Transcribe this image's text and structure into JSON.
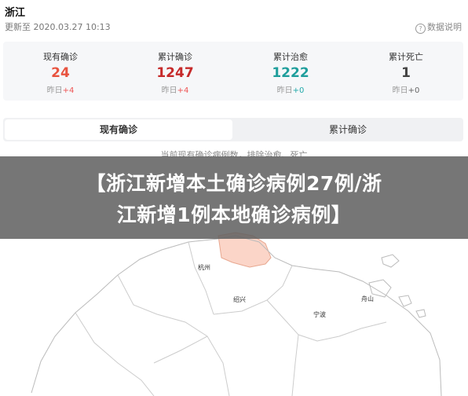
{
  "header": {
    "title": "浙江",
    "update_time": "更新至 2020.03.27 10:13",
    "help_label": "数据说明"
  },
  "stats": [
    {
      "label": "现有确诊",
      "value": "24",
      "delta_prefix": "昨日",
      "delta": "+4",
      "color": "#e8533f"
    },
    {
      "label": "累计确诊",
      "value": "1247",
      "delta_prefix": "昨日",
      "delta": "+4",
      "color": "#c62a2a"
    },
    {
      "label": "累计治愈",
      "value": "1222",
      "delta_prefix": "昨日",
      "delta": "+0",
      "color": "#1f9e9c"
    },
    {
      "label": "累计死亡",
      "value": "1",
      "delta_prefix": "昨日",
      "delta": "+0",
      "color": "#444444"
    }
  ],
  "tabs": [
    {
      "label": "现有确诊",
      "active": true
    },
    {
      "label": "累计确诊",
      "active": false
    }
  ],
  "map_note": "当前现有确诊病例数，排除治愈、死亡",
  "map": {
    "cities": [
      "杭州",
      "绍兴",
      "宁波",
      "舟山"
    ],
    "highlight_color": "#fbd5c8"
  },
  "banner": {
    "line1": "【浙江新增本土确诊病例27例/浙",
    "line2": "江新增1例本地确诊病例】"
  }
}
